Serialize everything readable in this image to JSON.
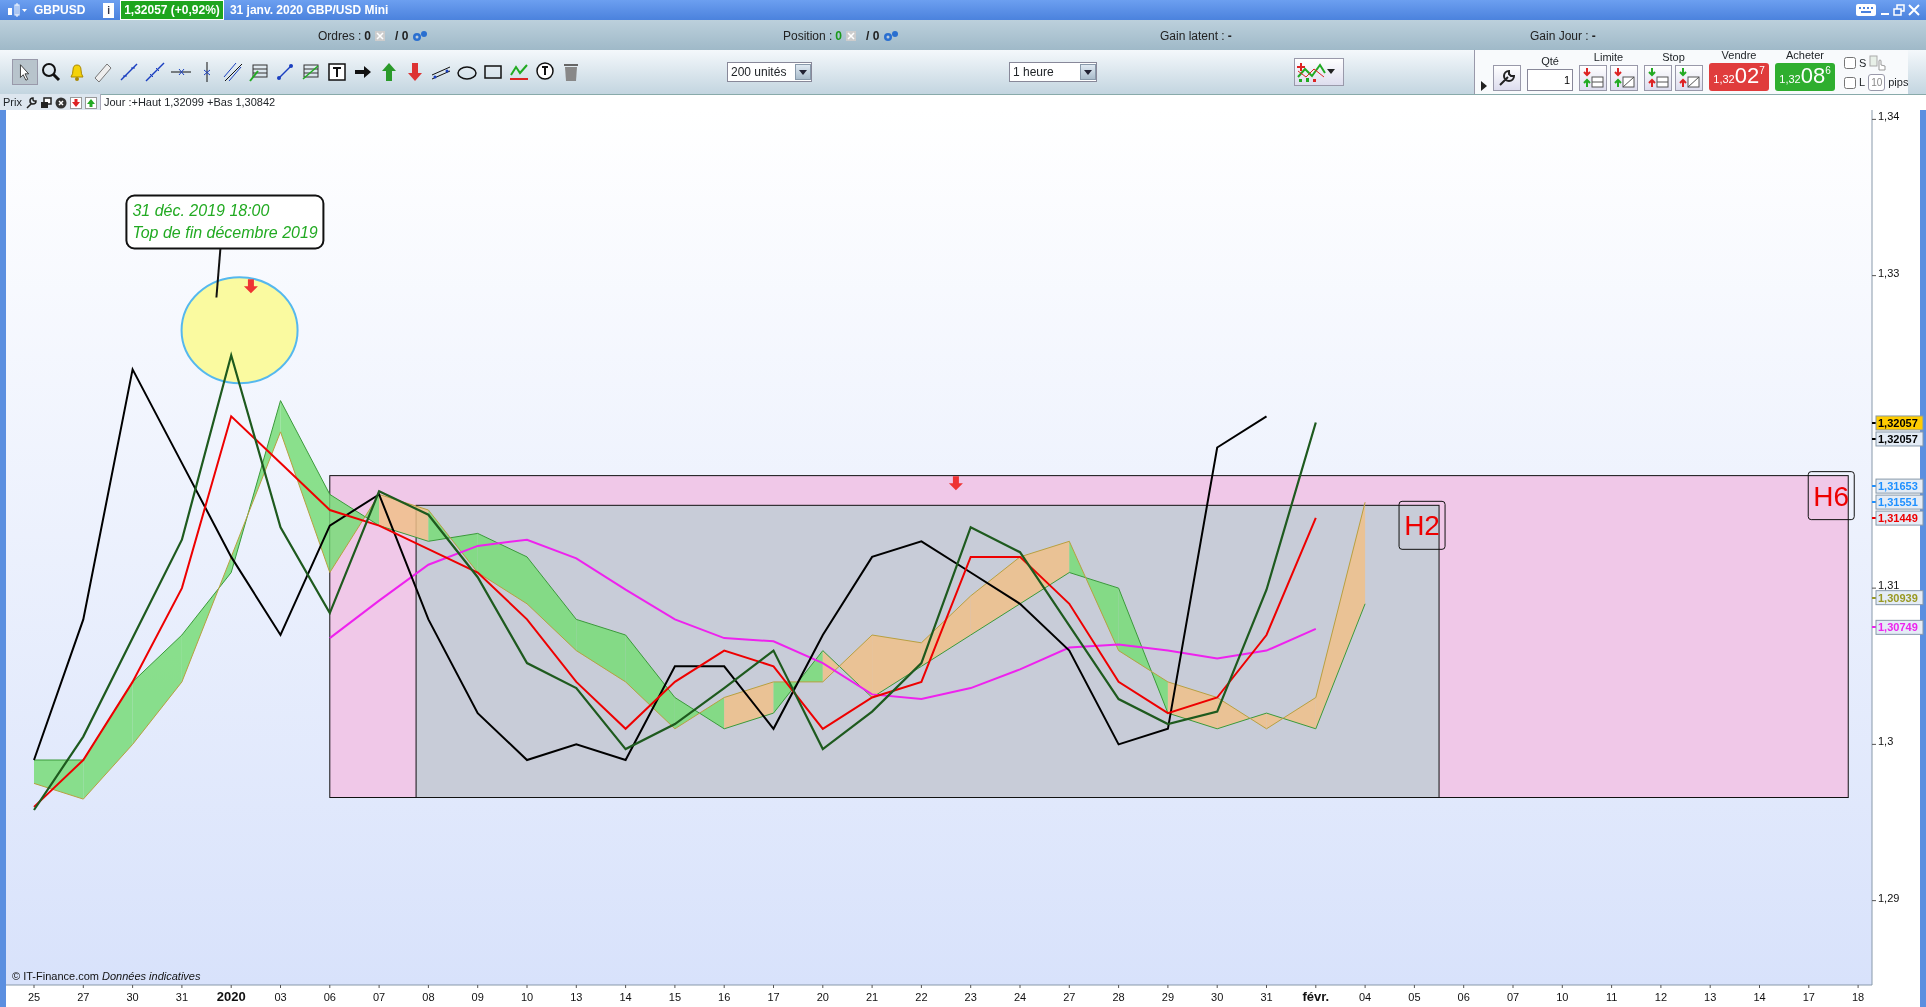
{
  "title_bar": {
    "symbol": "GBPUSD",
    "info": "i",
    "price_badge": "1,32057 (+0,92%)",
    "description": "31 janv. 2020 GBP/USD Mini"
  },
  "account_bar": [
    {
      "label": "Ordres :",
      "value": "0",
      "total": "/ 0",
      "kind": "count"
    },
    {
      "label": "Position :",
      "value": "0",
      "total": "/ 0",
      "kind": "count"
    },
    {
      "label": "Gain latent :",
      "value": "-",
      "kind": "plain"
    },
    {
      "label": "Gain Jour :",
      "value": "-",
      "kind": "plain"
    }
  ],
  "toolbar": {
    "size_select": "200 unités",
    "period_select": "1 heure"
  },
  "order_panel": {
    "qty_label": "Qté",
    "qty": "1",
    "limit_label": "Limite",
    "stop_label": "Stop",
    "sell": {
      "label": "Vendre",
      "prefix": "1,32",
      "big": "02",
      "sup": "7"
    },
    "buy": {
      "label": "Acheter",
      "prefix": "1,32",
      "big": "08",
      "sup": "6"
    },
    "checks": [
      {
        "label": "S",
        "checked": false
      },
      {
        "label": "L",
        "checked": false
      }
    ],
    "pips_value": "10",
    "pips_label": "pips"
  },
  "legend": {
    "label": "Prix",
    "text": "Jour :+Haut 1,32099 +Bas 1,30842"
  },
  "chart": {
    "footer": {
      "copyright": "© IT-Finance.com",
      "note": "Données indicatives"
    },
    "zones": [
      {
        "label": "H6",
        "color": "#f0c8e8"
      },
      {
        "label": "H2",
        "color": "#c8ccd8"
      }
    ],
    "callout": {
      "lines": [
        "31 déc. 2019 18:00",
        "Top de fin décembre 2019"
      ]
    },
    "price_labels": [
      {
        "text": "1,32057",
        "color": "#000000",
        "highlight": true
      },
      {
        "text": "1,32057",
        "color": "#000000",
        "highlight": false
      },
      {
        "text": "1,31653",
        "color": "#1e90ff",
        "highlight": false
      },
      {
        "text": "1,31551",
        "color": "#1e90ff",
        "highlight": false
      },
      {
        "text": "1,31449",
        "color": "#ee0000",
        "highlight": false
      },
      {
        "text": "1,30939",
        "color": "#999922",
        "highlight": false
      },
      {
        "text": "1,30749",
        "color": "#ee22ee",
        "highlight": false
      }
    ],
    "chart_data": {
      "type": "line",
      "categories": [
        "25",
        "27",
        "30",
        "31",
        "2020",
        "03",
        "06",
        "07",
        "08",
        "09",
        "10",
        "13",
        "14",
        "15",
        "16",
        "17",
        "20",
        "21",
        "22",
        "23",
        "24",
        "27",
        "28",
        "29",
        "30",
        "31",
        "févr.",
        "04",
        "05",
        "06",
        "07",
        "10",
        "11",
        "12",
        "13",
        "14",
        "17",
        "18"
      ],
      "ylim": [
        1.2846,
        1.3406
      ],
      "yticks": [
        {
          "value": 1.34,
          "label": "1,34"
        },
        {
          "value": 1.33,
          "label": "1,33"
        },
        {
          "value": 1.31,
          "label": "1,31"
        },
        {
          "value": 1.3,
          "label": "1,3"
        },
        {
          "value": 1.29,
          "label": "1,29"
        }
      ],
      "series": [
        {
          "color": "#3a9a3a",
          "values": [
            1.299,
            1.299,
            1.304,
            1.307,
            1.311,
            1.322,
            1.316,
            1.314,
            1.313,
            1.3135,
            1.312,
            1.308,
            1.307,
            1.303,
            1.301,
            1.302,
            1.306,
            1.303,
            1.305,
            1.307,
            1.309,
            1.311,
            1.31,
            1.302,
            1.301,
            1.302,
            1.301,
            1.309,
            null,
            null,
            null,
            null,
            null,
            null,
            null,
            null,
            null,
            null
          ]
        },
        {
          "color": "#b8a040",
          "values": [
            1.2975,
            1.2965,
            1.3,
            1.304,
            1.312,
            1.32,
            1.311,
            1.316,
            1.315,
            1.311,
            1.309,
            1.306,
            1.304,
            1.301,
            1.303,
            1.304,
            1.304,
            1.307,
            1.3065,
            1.3095,
            1.312,
            1.313,
            1.306,
            1.304,
            1.303,
            1.301,
            1.303,
            1.3155,
            null,
            null,
            null,
            null,
            null,
            null,
            null,
            null,
            null,
            null
          ]
        },
        {
          "color": "#ee22ee",
          "values": [
            null,
            null,
            null,
            null,
            null,
            null,
            1.3068,
            1.3092,
            1.3115,
            1.3127,
            1.3131,
            1.3119,
            1.3099,
            1.308,
            1.3068,
            1.3066,
            1.3052,
            1.3032,
            1.3029,
            1.3036,
            1.3048,
            1.3062,
            1.3064,
            1.306,
            1.3055,
            1.306,
            1.3074,
            null,
            null,
            null,
            null,
            null,
            null,
            null,
            null,
            null,
            null,
            null
          ]
        },
        {
          "color": "#000000",
          "values": [
            1.299,
            1.308,
            1.324,
            1.318,
            1.312,
            1.307,
            1.314,
            1.316,
            1.308,
            1.302,
            1.299,
            1.3,
            1.299,
            1.305,
            1.305,
            1.301,
            1.307,
            1.312,
            1.313,
            1.311,
            1.309,
            1.306,
            1.3,
            1.301,
            1.319,
            1.321,
            null,
            null,
            null,
            null,
            null,
            null,
            null,
            null,
            null,
            null,
            null,
            null
          ]
        },
        {
          "color": "#ee0000",
          "values": [
            1.296,
            1.299,
            1.304,
            1.31,
            1.321,
            1.318,
            1.315,
            1.314,
            1.3125,
            1.311,
            1.308,
            1.304,
            1.301,
            1.304,
            1.306,
            1.305,
            1.301,
            1.303,
            1.304,
            1.312,
            1.312,
            1.309,
            1.304,
            1.302,
            1.303,
            1.307,
            1.3145,
            null,
            null,
            null,
            null,
            null,
            null,
            null,
            null,
            null,
            null,
            null
          ]
        },
        {
          "color": "#1e5a1e",
          "values": [
            1.2958,
            1.3005,
            1.3068,
            1.3131,
            1.3249,
            1.3139,
            1.3084,
            1.3162,
            1.3147,
            1.3107,
            1.3052,
            1.3036,
            1.2997,
            1.3013,
            1.3036,
            1.306,
            1.2997,
            1.3021,
            1.3052,
            1.3139,
            1.3123,
            1.3076,
            1.3029,
            1.3013,
            1.3021,
            1.3099,
            1.3206,
            null,
            null,
            null,
            null,
            null,
            null,
            null,
            null,
            null,
            null,
            null
          ]
        }
      ]
    }
  }
}
